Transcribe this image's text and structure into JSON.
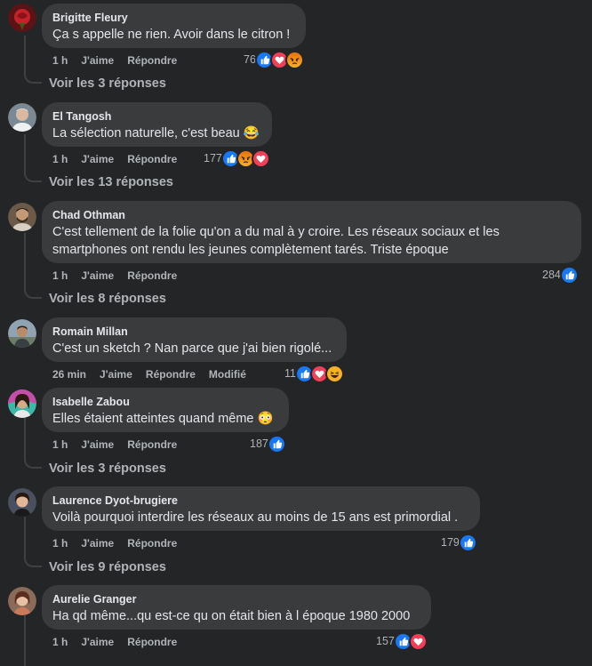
{
  "comments": [
    {
      "author": "Brigitte Fleury",
      "text": "Ça s appelle ne rien. Avoir dans le citron !",
      "time": "1 h",
      "like": "J'aime",
      "reply": "Répondre",
      "count": "76",
      "replies": "Voir les 3 réponses"
    },
    {
      "author": "El Tangosh",
      "text": "La sélection naturelle, c'est beau 😂",
      "time": "1 h",
      "like": "J'aime",
      "reply": "Répondre",
      "count": "177",
      "replies": "Voir les 13 réponses"
    },
    {
      "author": "Chad Othman",
      "text_line1": "C'est tellement de la folie qu'on a du mal à y croire. Les réseaux sociaux et les",
      "text_line2": "smartphones ont rendu les jeunes complètement tarés. Triste époque",
      "time": "1 h",
      "like": "J'aime",
      "reply": "Répondre",
      "count": "284",
      "replies": "Voir les 8 réponses"
    },
    {
      "author": "Romain Millan",
      "text": "C'est un sketch ? Nan parce que j'ai bien rigolé...",
      "time": "26 min",
      "like": "J'aime",
      "reply": "Répondre",
      "modified": "Modifié",
      "count": "11"
    },
    {
      "author": "Isabelle Zabou",
      "text": "Elles étaient atteintes quand même 😳",
      "time": "1 h",
      "like": "J'aime",
      "reply": "Répondre",
      "count": "187",
      "replies": "Voir les 3 réponses"
    },
    {
      "author": "Laurence Dyot-brugiere",
      "text": "Voilà pourquoi interdire les réseaux au moins de 15 ans est primordial .",
      "time": "1 h",
      "like": "J'aime",
      "reply": "Répondre",
      "count": "179",
      "replies": "Voir les 9 réponses"
    },
    {
      "author": "Aurelie Granger",
      "text": "Ha qd même...qu est-ce qu on était bien à l époque 1980 2000",
      "time": "1 h",
      "like": "J'aime",
      "reply": "Répondre",
      "count": "157"
    }
  ],
  "colors": {
    "background": "#242526",
    "bubble": "#3a3b3c",
    "like_blue": "#1877f2",
    "love_red": "#f33e58",
    "angry_orange": "#e9710f",
    "haha_yellow": "#f7b125"
  }
}
